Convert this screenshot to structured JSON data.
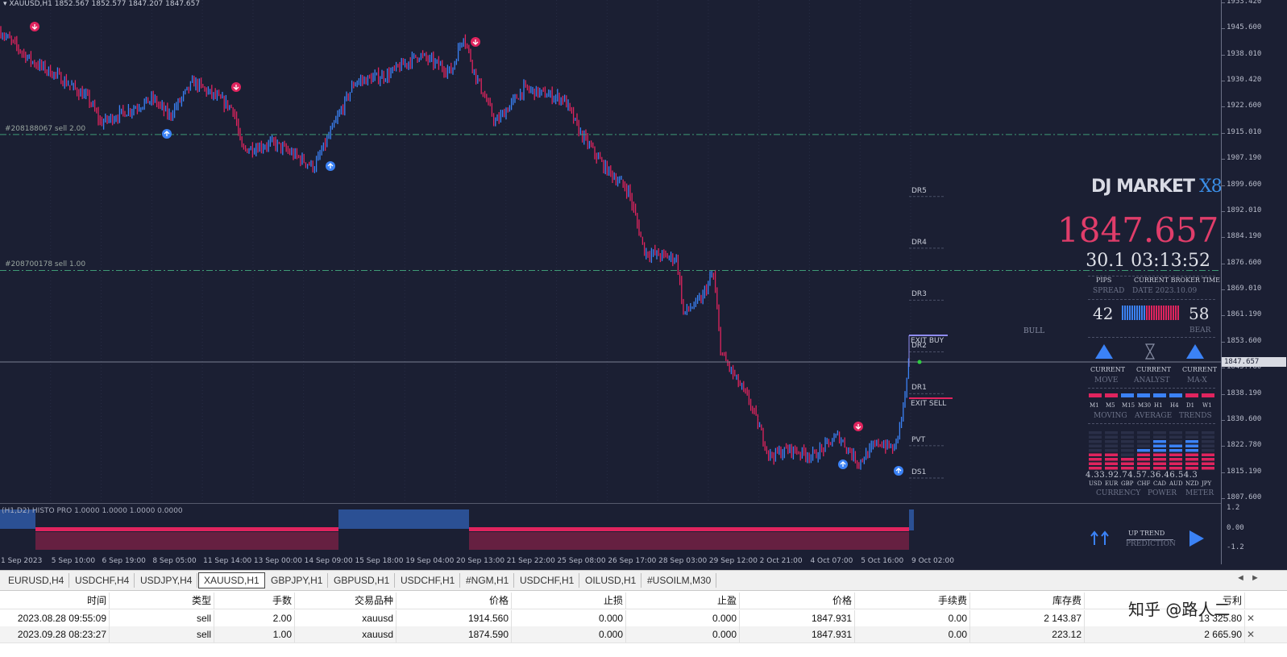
{
  "chart": {
    "header": "▾ XAUUSD,H1  1852.567 1852.577 1847.207 1847.657",
    "current_price": "1847.657",
    "price_ticks": [
      "1953.420",
      "1945.600",
      "1938.010",
      "1930.420",
      "1922.600",
      "1915.010",
      "1907.190",
      "1899.600",
      "1892.010",
      "1884.190",
      "1876.600",
      "1869.010",
      "1861.190",
      "1853.600",
      "1845.780",
      "1838.190",
      "1830.600",
      "1822.780",
      "1815.190",
      "1807.600"
    ],
    "indicator_ticks": [
      "1.2",
      "0.00",
      "-1.2"
    ],
    "time_ticks": [
      "1 Sep 2023",
      "5 Sep 10:00",
      "6 Sep 19:00",
      "8 Sep 05:00",
      "11 Sep 14:00",
      "13 Sep 00:00",
      "14 Sep 09:00",
      "15 Sep 18:00",
      "19 Sep 04:00",
      "20 Sep 13:00",
      "21 Sep 22:00",
      "25 Sep 08:00",
      "26 Sep 17:00",
      "28 Sep 03:00",
      "29 Sep 12:00",
      "2 Oct 21:00",
      "4 Oct 07:00",
      "5 Oct 16:00",
      "9 Oct 02:00"
    ],
    "orders": [
      {
        "label": "#208188067 sell 2.00",
        "price": 1914.56
      },
      {
        "label": "#208700178 sell 1.00",
        "price": 1874.59
      }
    ],
    "levels": [
      {
        "label": "DR5",
        "price": 1898.0
      },
      {
        "label": "DR4",
        "price": 1882.8
      },
      {
        "label": "DR3",
        "price": 1867.5
      },
      {
        "label": "DR2",
        "price": 1852.3
      },
      {
        "label": "DR1",
        "price": 1840.0
      },
      {
        "label": "PVT",
        "price": 1824.7
      },
      {
        "label": "DS1",
        "price": 1815.2
      }
    ],
    "exit_buy": "EXIT BUY",
    "exit_sell": "EXIT SELL",
    "bull_label": "BULL",
    "indicator_label": "(H1,D2) HISTO PRO 1.0000 1.0000 1.0000 0.0000",
    "colors": {
      "bull": "#3b82f6",
      "bear": "#e0245e",
      "background": "#1b1f33"
    }
  },
  "dj_panel": {
    "logo": "DJ MARKET",
    "logo_suffix": "X8",
    "price": "1847.657",
    "time": "30.1 03:13:52",
    "pips_label": "PIPS",
    "spread_label": "SPREAD",
    "broker_time_label": "CURRENT BROKER TIME",
    "date_label": "DATE 2023.10.09",
    "bull_count": "42",
    "bear_count": "58",
    "bear_label": "BEAR",
    "current_labels": [
      "CURRENT",
      "CURRENT",
      "CURRENT"
    ],
    "signal_labels": [
      "MOVE",
      "ANALYST",
      "MA-X"
    ],
    "timeframes": [
      "M1",
      "M5",
      "M15",
      "M30",
      "H1",
      "H4",
      "D1",
      "W1"
    ],
    "trend_labels": [
      "MOVING",
      "AVERAGE",
      "TRENDS"
    ],
    "strength_values": "4.33.92.74.57.36.46.54.3",
    "currencies": [
      "USD",
      "EUR",
      "GBP",
      "CHF",
      "CAD",
      "AUD",
      "NZD",
      "JPY"
    ],
    "meter_labels": [
      "CURRENCY",
      "POWER",
      "METER"
    ],
    "up_trend": "UP TREND",
    "prediction": "PREDICTION"
  },
  "tabs": {
    "items": [
      "EURUSD,H4",
      "USDCHF,H4",
      "USDJPY,H4",
      "XAUUSD,H1",
      "GBPJPY,H1",
      "GBPUSD,H1",
      "USDCHF,H1",
      "#NGM,H1",
      "USDCHF,H1",
      "OILUSD,H1",
      "#USOILM,M30"
    ],
    "active_index": 3,
    "nav_left": "◄",
    "nav_right": "►"
  },
  "table": {
    "headers": [
      "时间",
      "类型",
      "手数",
      "交易品种",
      "价格",
      "止损",
      "止盈",
      "价格",
      "手续费",
      "库存费",
      "亏利"
    ],
    "rows": [
      [
        "2023.08.28 09:55:09",
        "sell",
        "2.00",
        "xauusd",
        "1914.560",
        "0.000",
        "0.000",
        "1847.931",
        "0.00",
        "2 143.87",
        "13 325.80"
      ],
      [
        "2023.09.28 08:23:27",
        "sell",
        "1.00",
        "xauusd",
        "1874.590",
        "0.000",
        "0.000",
        "1847.931",
        "0.00",
        "223.12",
        "2 665.90"
      ]
    ],
    "close_icon": "✕"
  },
  "watermark": "知乎 @路人二"
}
